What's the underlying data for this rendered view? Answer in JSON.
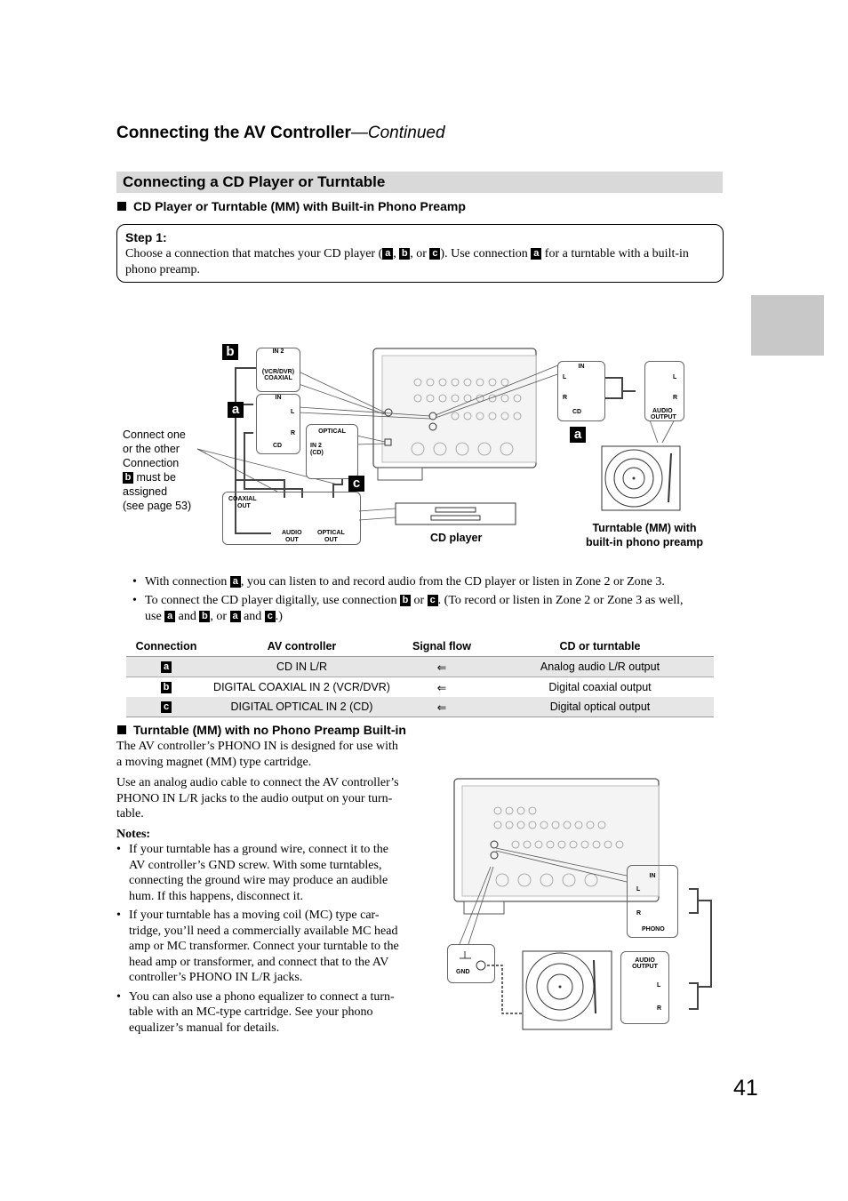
{
  "header": {
    "title": "Connecting the AV Controller",
    "continued": "—Continued"
  },
  "section": {
    "title": "Connecting a CD Player or Turntable"
  },
  "sub1": "CD Player or Turntable (MM) with Built-in Phono Preamp",
  "step": {
    "title": "Step 1:",
    "text_1": "Choose a connection that matches your CD player (",
    "text_2": ", ",
    "text_3": ", or ",
    "text_4": "). Use connection ",
    "text_5": " for a turntable with a built-in phono preamp."
  },
  "keys": {
    "a": "a",
    "b": "b",
    "c": "c"
  },
  "diagram1": {
    "in2": "IN 2",
    "vcrdvr": "(VCR/DVR)",
    "coaxial": "COAXIAL",
    "in": "IN",
    "l": "L",
    "r": "R",
    "cd": "CD",
    "optical": "OPTICAL",
    "in2cd_1": "IN 2",
    "in2cd_2": "(CD)",
    "coaxial_out_1": "COAXIAL",
    "coaxial_out_2": "OUT",
    "audio_out_1": "AUDIO",
    "audio_out_2": "OUT",
    "optical_out_1": "OPTICAL",
    "optical_out_2": "OUT",
    "note": [
      "Connect one",
      "or the other",
      "Connection"
    ],
    "note_2": " must be",
    "note_3": "assigned",
    "note_4": "(see page 53)",
    "cd_player": "CD player",
    "audio_output_1": "AUDIO",
    "audio_output_2": "OUTPUT",
    "turntable_1": "Turntable (MM) with",
    "turntable_2": "built-in phono preamp"
  },
  "bullets1": {
    "b1_1": "With connection ",
    "b1_2": ", you can listen to and record audio from the CD player or listen in Zone 2 or Zone 3.",
    "b2_1": "To connect the CD player digitally, use connection ",
    "b2_2": " or ",
    "b2_3": ". (To record or listen in Zone 2 or Zone 3 as well,",
    "b2_4": "use ",
    "b2_5": " and ",
    "b2_6": ", or ",
    "b2_7": " and ",
    "b2_8": ".)"
  },
  "table": {
    "headers": [
      "Connection",
      "AV controller",
      "Signal flow",
      "CD or turntable"
    ],
    "rows": [
      {
        "key": "a",
        "av": "CD IN L/R",
        "flow": "⇐",
        "device": "Analog audio L/R output"
      },
      {
        "key": "b",
        "av": "DIGITAL COAXIAL IN 2 (VCR/DVR)",
        "flow": "⇐",
        "device": "Digital coaxial output"
      },
      {
        "key": "c",
        "av": "DIGITAL OPTICAL IN 2 (CD)",
        "flow": "⇐",
        "device": "Digital optical output"
      }
    ]
  },
  "sub2": "Turntable (MM) with no Phono Preamp Built-in",
  "para1": "The AV controller’s PHONO IN is designed for use with a moving magnet (MM) type cartridge.",
  "para2": "Use an analog audio cable to connect the AV controller’s PHONO IN L/R jacks to the audio output on your turn-table.",
  "notes_title": "Notes:",
  "notes": [
    "If your turntable has a ground wire, connect it to the AV controller’s GND screw. With some turntables, connecting the ground wire may produce an audible hum. If this happens, disconnect it.",
    "If your turntable has a moving coil (MC) type car-tridge, you’ll need a commercially available MC head amp or MC transformer. Connect your turntable to the head amp or transformer, and connect that to the AV controller’s PHONO IN L/R jacks.",
    "You can also use a phono equalizer to connect a turn-table with an MC-type cartridge. See your phono equalizer’s manual for details."
  ],
  "diagram2": {
    "in": "IN",
    "l": "L",
    "r": "R",
    "phono": "PHONO",
    "gnd": "GND",
    "audio_output_1": "AUDIO",
    "audio_output_2": "OUTPUT"
  },
  "page_number": "41"
}
